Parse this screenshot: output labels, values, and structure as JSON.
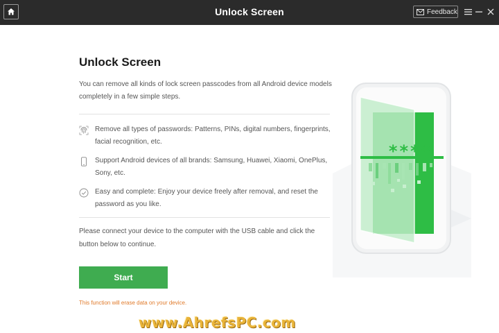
{
  "window": {
    "title": "Unlock Screen",
    "feedback_label": "Feedback"
  },
  "main": {
    "title": "Unlock Screen",
    "description": "You can remove all kinds of lock screen passcodes from all Android device models completely in a few simple steps.",
    "features": [
      {
        "icon": "fingerprint-icon",
        "text": "Remove all types of passwords: Patterns, PINs, digital numbers, fingerprints, facial recognition, etc."
      },
      {
        "icon": "phone-icon",
        "text": "Support Android devices of all brands: Samsung, Huawei, Xiaomi, OnePlus, Sony, etc."
      },
      {
        "icon": "check-circle-icon",
        "text": "Easy and complete: Enjoy your device freely after removal, and reset the password as you like."
      }
    ],
    "connect_text": "Please connect your device to the computer with the USB cable and click the button below to continue.",
    "start_label": "Start",
    "warning": "This function will erase data on your device."
  },
  "illustration": {
    "password_mask": "****",
    "accent_color": "#2ebd45"
  },
  "watermark": "www.AhrefsPC.com",
  "colors": {
    "titlebar": "#2b2b2b",
    "button": "#3fac50",
    "warning": "#e07a2a"
  }
}
